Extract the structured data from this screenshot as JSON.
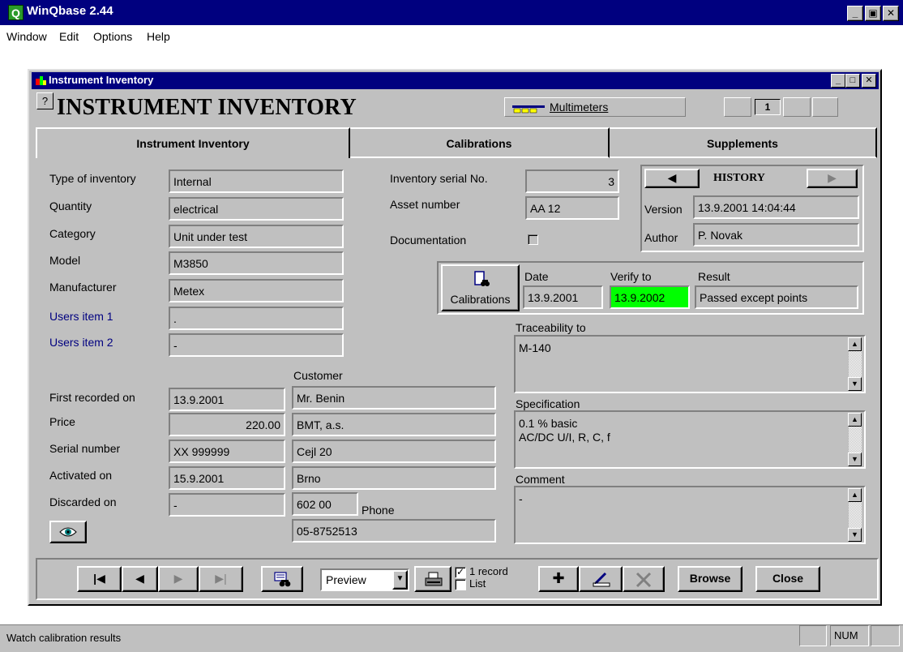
{
  "app": {
    "title": "WinQbase 2.44",
    "icon_letter": "Q",
    "controls": [
      "_",
      "▣",
      "✕"
    ]
  },
  "menu": {
    "items": [
      "Window",
      "Edit",
      "Options",
      "Help"
    ]
  },
  "window": {
    "title": "Instrument Inventory",
    "controls": [
      "_",
      "□",
      "✕"
    ],
    "help": "?",
    "heading": "INSTRUMENT INVENTORY",
    "group": "Multimeters",
    "record_counter": "1"
  },
  "tabs": [
    "Instrument Inventory",
    "Calibrations",
    "Supplements"
  ],
  "left_fields": [
    {
      "label": "Type of inventory",
      "value": "Internal"
    },
    {
      "label": "Quantity",
      "value": "electrical"
    },
    {
      "label": "Category",
      "value": "Unit under test"
    },
    {
      "label": "Model",
      "value": "M3850"
    },
    {
      "label": "Manufacturer",
      "value": "Metex"
    },
    {
      "label": "Users item 1",
      "value": "."
    },
    {
      "label": "Users item 2",
      "value": "-"
    }
  ],
  "inventory": {
    "serial_label": "Inventory serial No.",
    "serial_value": "3",
    "asset_label": "Asset number",
    "asset_value": "AA 12",
    "documentation_label": "Documentation"
  },
  "history": {
    "title": "HISTORY",
    "version_label": "Version",
    "version_value": "13.9.2001 14:04:44",
    "author_label": "Author",
    "author_value": "P. Novak"
  },
  "calibration": {
    "button_label": "Calibrations",
    "date_label": "Date",
    "date_value": "13.9.2001",
    "verify_label": "Verify to",
    "verify_value": "13.9.2002",
    "verify_color": "#00ff00",
    "result_label": "Result",
    "result_value": "Passed except points"
  },
  "lower_fields": [
    {
      "label": "First recorded on",
      "value": "13.9.2001"
    },
    {
      "label": "Price",
      "value": "220.00"
    },
    {
      "label": "Serial number",
      "value": "XX 999999"
    },
    {
      "label": "Activated on",
      "value": "15.9.2001"
    },
    {
      "label": "Discarded on",
      "value": "-"
    }
  ],
  "customer": {
    "label": "Customer",
    "name": "Mr. Benin",
    "company": "BMT, a.s.",
    "street": "Cejl 20",
    "city": "Brno",
    "zip": "602 00",
    "phone_label": "Phone",
    "phone": "05-8752513"
  },
  "memos": {
    "traceability_label": "Traceability to",
    "traceability_value": "M-140",
    "specification_label": "Specification",
    "specification_value": "0.1 % basic\nAC/DC U/I, R, C, f",
    "comment_label": "Comment",
    "comment_value": "-"
  },
  "toolbar": {
    "output_selected": "Preview",
    "record_option": "1 record",
    "list_option": "List",
    "browse_label": "Browse",
    "close_label": "Close"
  },
  "status": {
    "text": "Watch calibration results",
    "num": "NUM"
  }
}
